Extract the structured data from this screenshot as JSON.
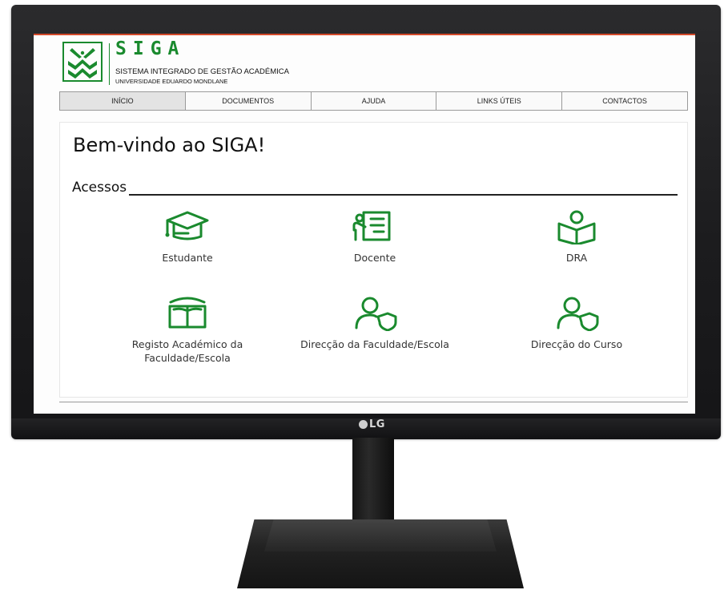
{
  "monitor": {
    "brand": "LG"
  },
  "header": {
    "title": "SIGA",
    "subtitle": "SISTEMA INTEGRADO DE GESTÃO ACADÉMICA",
    "university": "UNIVERSIDADE EDUARDO MONDLANE"
  },
  "nav": {
    "items": [
      {
        "label": "INÍCIO"
      },
      {
        "label": "DOCUMENTOS"
      },
      {
        "label": "AJUDA"
      },
      {
        "label": "LINKS ÚTEIS"
      },
      {
        "label": "CONTACTOS"
      }
    ],
    "active_index": 0
  },
  "main": {
    "welcome": "Bem-vindo ao SIGA!",
    "section_title": "Acessos",
    "cards": [
      {
        "label": "Estudante",
        "icon": "graduation-cap-icon"
      },
      {
        "label": "Docente",
        "icon": "teacher-board-icon"
      },
      {
        "label": "DRA",
        "icon": "reader-book-icon"
      },
      {
        "label": "Registo Académico da Faculdade/Escola",
        "icon": "open-book-icon"
      },
      {
        "label": "Direcção da Faculdade/Escola",
        "icon": "user-shield-icon"
      },
      {
        "label": "Direcção do Curso",
        "icon": "user-shield-icon"
      }
    ]
  },
  "colors": {
    "brand_green": "#1a8a2e",
    "bezel": "#1c1c1e"
  }
}
